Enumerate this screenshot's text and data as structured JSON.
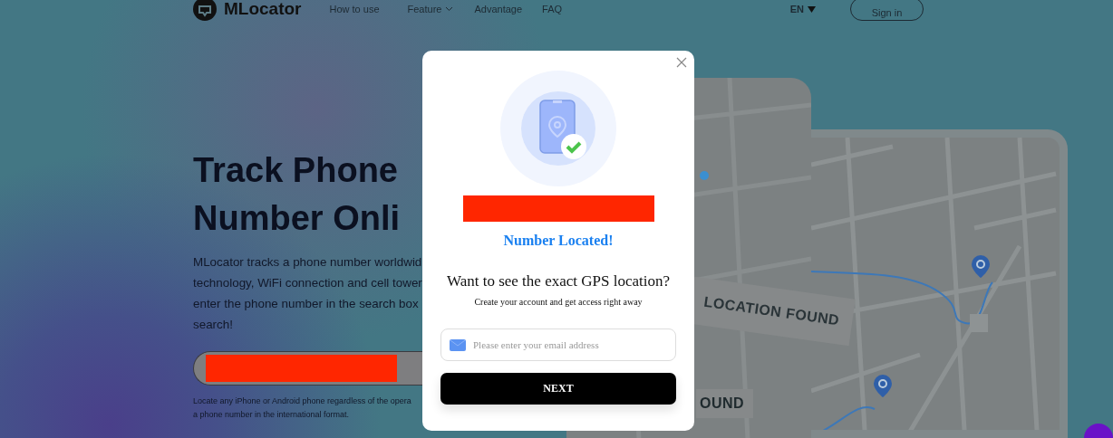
{
  "header": {
    "logo": "MLocator",
    "nav": [
      {
        "label": "How to use",
        "dropdown": false
      },
      {
        "label": "Feature",
        "dropdown": true
      },
      {
        "label": "Advantage",
        "dropdown": false
      },
      {
        "label": "FAQ",
        "dropdown": false
      }
    ],
    "language": "EN",
    "sign_in": "Sign in"
  },
  "hero": {
    "title_lines": [
      "Track Phone",
      "Number Onli"
    ],
    "description_lines": [
      "MLocator tracks a phone number worldwid",
      "technology, WiFi connection and cell tower",
      "enter the phone number in the search box",
      "search!"
    ],
    "note_lines": [
      "Locate any iPhone or Android phone regardless of the opera",
      "a phone number in the international format."
    ]
  },
  "map": {
    "labels": [
      "LOCATION FOUND",
      "OUND"
    ]
  },
  "modal": {
    "status": "Number Located!",
    "question": "Want to see the exact GPS location?",
    "subtitle": "Create your account and get access right away",
    "email": {
      "placeholder": "Please enter your email address"
    },
    "next": "NEXT"
  }
}
